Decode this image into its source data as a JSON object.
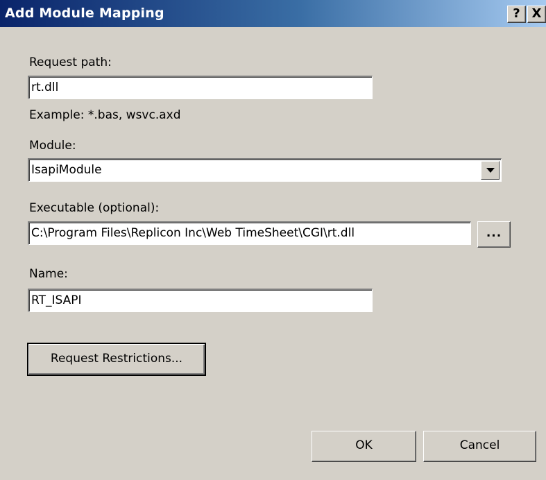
{
  "window": {
    "title": "Add Module Mapping",
    "help_glyph": "?",
    "close_glyph": "X"
  },
  "form": {
    "request_path": {
      "label": "Request path:",
      "value": "rt.dll",
      "example": "Example: *.bas, wsvc.axd"
    },
    "module": {
      "label": "Module:",
      "selected": "IsapiModule"
    },
    "executable": {
      "label": "Executable (optional):",
      "value": "C:\\Program Files\\Replicon Inc\\Web TimeSheet\\CGI\\rt.dll",
      "browse_label": "..."
    },
    "name": {
      "label": "Name:",
      "value": "RT_ISAPI"
    },
    "restrictions_button": "Request Restrictions..."
  },
  "footer": {
    "ok_label": "OK",
    "cancel_label": "Cancel"
  },
  "icons": {
    "dropdown": "chevron-down-icon",
    "help": "help-icon",
    "close": "close-icon"
  }
}
